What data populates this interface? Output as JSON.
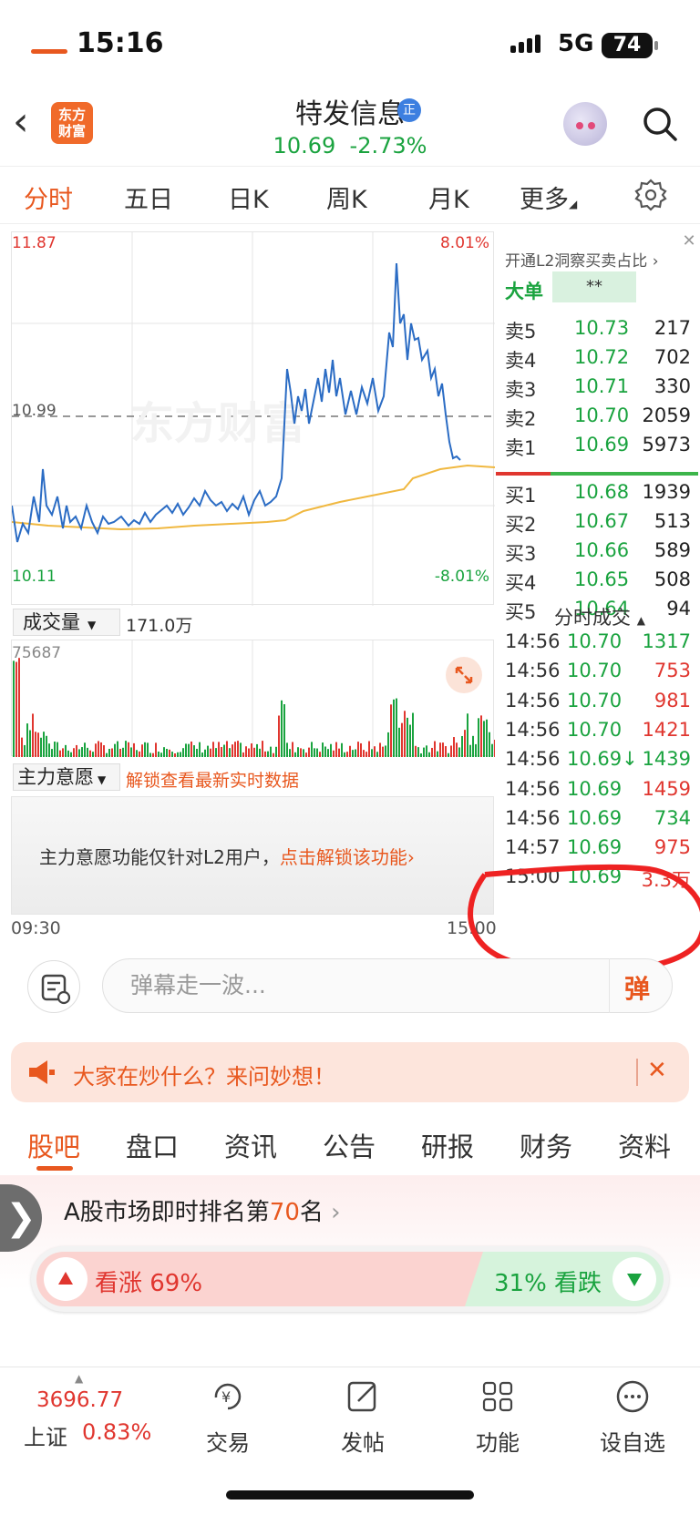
{
  "status_bar": {
    "time": "15:16",
    "network": "5G",
    "battery": "74"
  },
  "header": {
    "stock_name": "特发信息",
    "badge": "正",
    "price": "10.69",
    "change": "-2.73%",
    "logo_line1": "东方",
    "logo_line2": "财富"
  },
  "period_tabs": [
    "分时",
    "五日",
    "日K",
    "周K",
    "月K",
    "更多"
  ],
  "chart": {
    "price_high": "11.87",
    "price_low": "10.11",
    "pct_high": "8.01%",
    "pct_low": "-8.01%",
    "ref_price": "10.99",
    "watermark": "东方财富",
    "time_start": "09:30",
    "time_end": "15:00"
  },
  "volume_panel": {
    "selector": "成交量",
    "total": "171.0万",
    "max": "75687"
  },
  "main_panel": {
    "selector": "主力意愿",
    "unlock_hint": "解锁查看最新实时数据",
    "notice": "主力意愿功能仅针对L2用户，",
    "notice_link": "点击解锁该功能"
  },
  "order_book": {
    "promo": "开通L2洞察买卖占比",
    "big_order_label": "大单",
    "big_order_a": "**",
    "big_order_b": "**",
    "sell": [
      {
        "label": "卖5",
        "price": "10.73",
        "vol": "217"
      },
      {
        "label": "卖4",
        "price": "10.72",
        "vol": "702"
      },
      {
        "label": "卖3",
        "price": "10.71",
        "vol": "330"
      },
      {
        "label": "卖2",
        "price": "10.70",
        "vol": "2059"
      },
      {
        "label": "卖1",
        "price": "10.69",
        "vol": "5973"
      }
    ],
    "buy": [
      {
        "label": "买1",
        "price": "10.68",
        "vol": "1939"
      },
      {
        "label": "买2",
        "price": "10.67",
        "vol": "513"
      },
      {
        "label": "买3",
        "price": "10.66",
        "vol": "589"
      },
      {
        "label": "买4",
        "price": "10.65",
        "vol": "508"
      },
      {
        "label": "买5",
        "price": "10.64",
        "vol": "94"
      }
    ],
    "ticks_title": "分时成交",
    "ticks": [
      {
        "time": "14:56",
        "price": "10.70",
        "vol": "1317",
        "dir": "green"
      },
      {
        "time": "14:56",
        "price": "10.70",
        "vol": "753",
        "dir": "red"
      },
      {
        "time": "14:56",
        "price": "10.70",
        "vol": "981",
        "dir": "red"
      },
      {
        "time": "14:56",
        "price": "10.70",
        "vol": "1421",
        "dir": "red"
      },
      {
        "time": "14:56",
        "price": "10.69↓",
        "vol": "1439",
        "dir": "green"
      },
      {
        "time": "14:56",
        "price": "10.69",
        "vol": "1459",
        "dir": "red"
      },
      {
        "time": "14:56",
        "price": "10.69",
        "vol": "734",
        "dir": "green"
      },
      {
        "time": "14:57",
        "price": "10.69",
        "vol": "975",
        "dir": "red"
      },
      {
        "time": "15:00",
        "price": "10.69",
        "vol": "3.3万",
        "dir": "red"
      }
    ]
  },
  "comment": {
    "placeholder": "弹幕走一波...",
    "send_label": "弹"
  },
  "banner": {
    "text": "大家在炒什么？来问妙想！"
  },
  "section_tabs": [
    "股吧",
    "盘口",
    "资讯",
    "公告",
    "研报",
    "财务",
    "资料"
  ],
  "ranking": {
    "prefix": "A股市场即时排名第",
    "rank": "70",
    "suffix": "名"
  },
  "vote": {
    "up_label": "看涨 69%",
    "down_label": "31% 看跌",
    "up_pct": 69
  },
  "bottom_nav": {
    "index_value": "3696.77",
    "index_name": "上证",
    "index_pct": "0.83%",
    "items": [
      "交易",
      "发帖",
      "功能",
      "设自选"
    ]
  },
  "colors": {
    "accent": "#e8581f",
    "up": "#e0362f",
    "down": "#1aa33f",
    "avg_line": "#f0b840",
    "price_line": "#2b6cc4"
  }
}
